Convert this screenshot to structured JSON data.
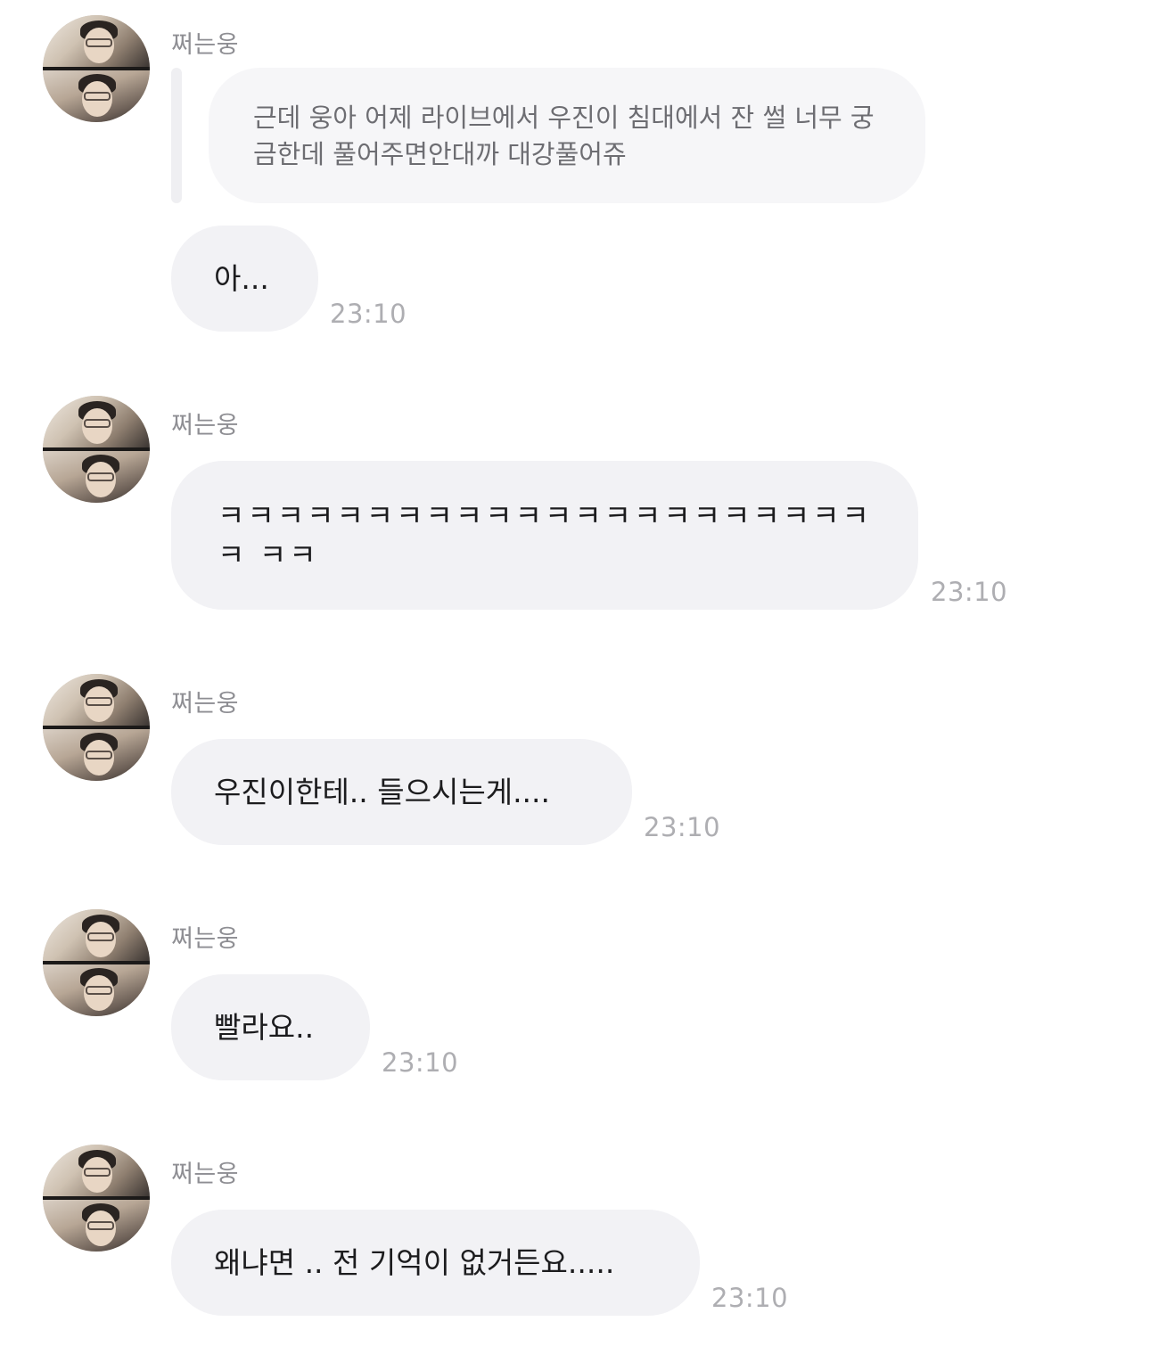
{
  "messages": [
    {
      "sender": "쩌는웅",
      "quote": "근데 웅아 어제 라이브에서 우진이 침대에서 잔 썰 너무 궁금한데 풀어주면안대까 대강풀어쥬",
      "text": "아...",
      "time": "23:10"
    },
    {
      "sender": "쩌는웅",
      "text": "ㅋㅋㅋㅋㅋㅋㅋㅋㅋㅋㅋㅋㅋㅋㅋㅋㅋㅋㅋㅋㅋㅋㅋ ㅋㅋ",
      "time": "23:10"
    },
    {
      "sender": "쩌는웅",
      "text": "우진이한테.. 들으시는게....",
      "time": "23:10"
    },
    {
      "sender": "쩌는웅",
      "text": "빨라요..",
      "time": "23:10"
    },
    {
      "sender": "쩌는웅",
      "text": "왜냐면 .. 전 기억이 없거든요.....",
      "time": "23:10"
    }
  ],
  "avatar_icon": "profile-photo-collage"
}
